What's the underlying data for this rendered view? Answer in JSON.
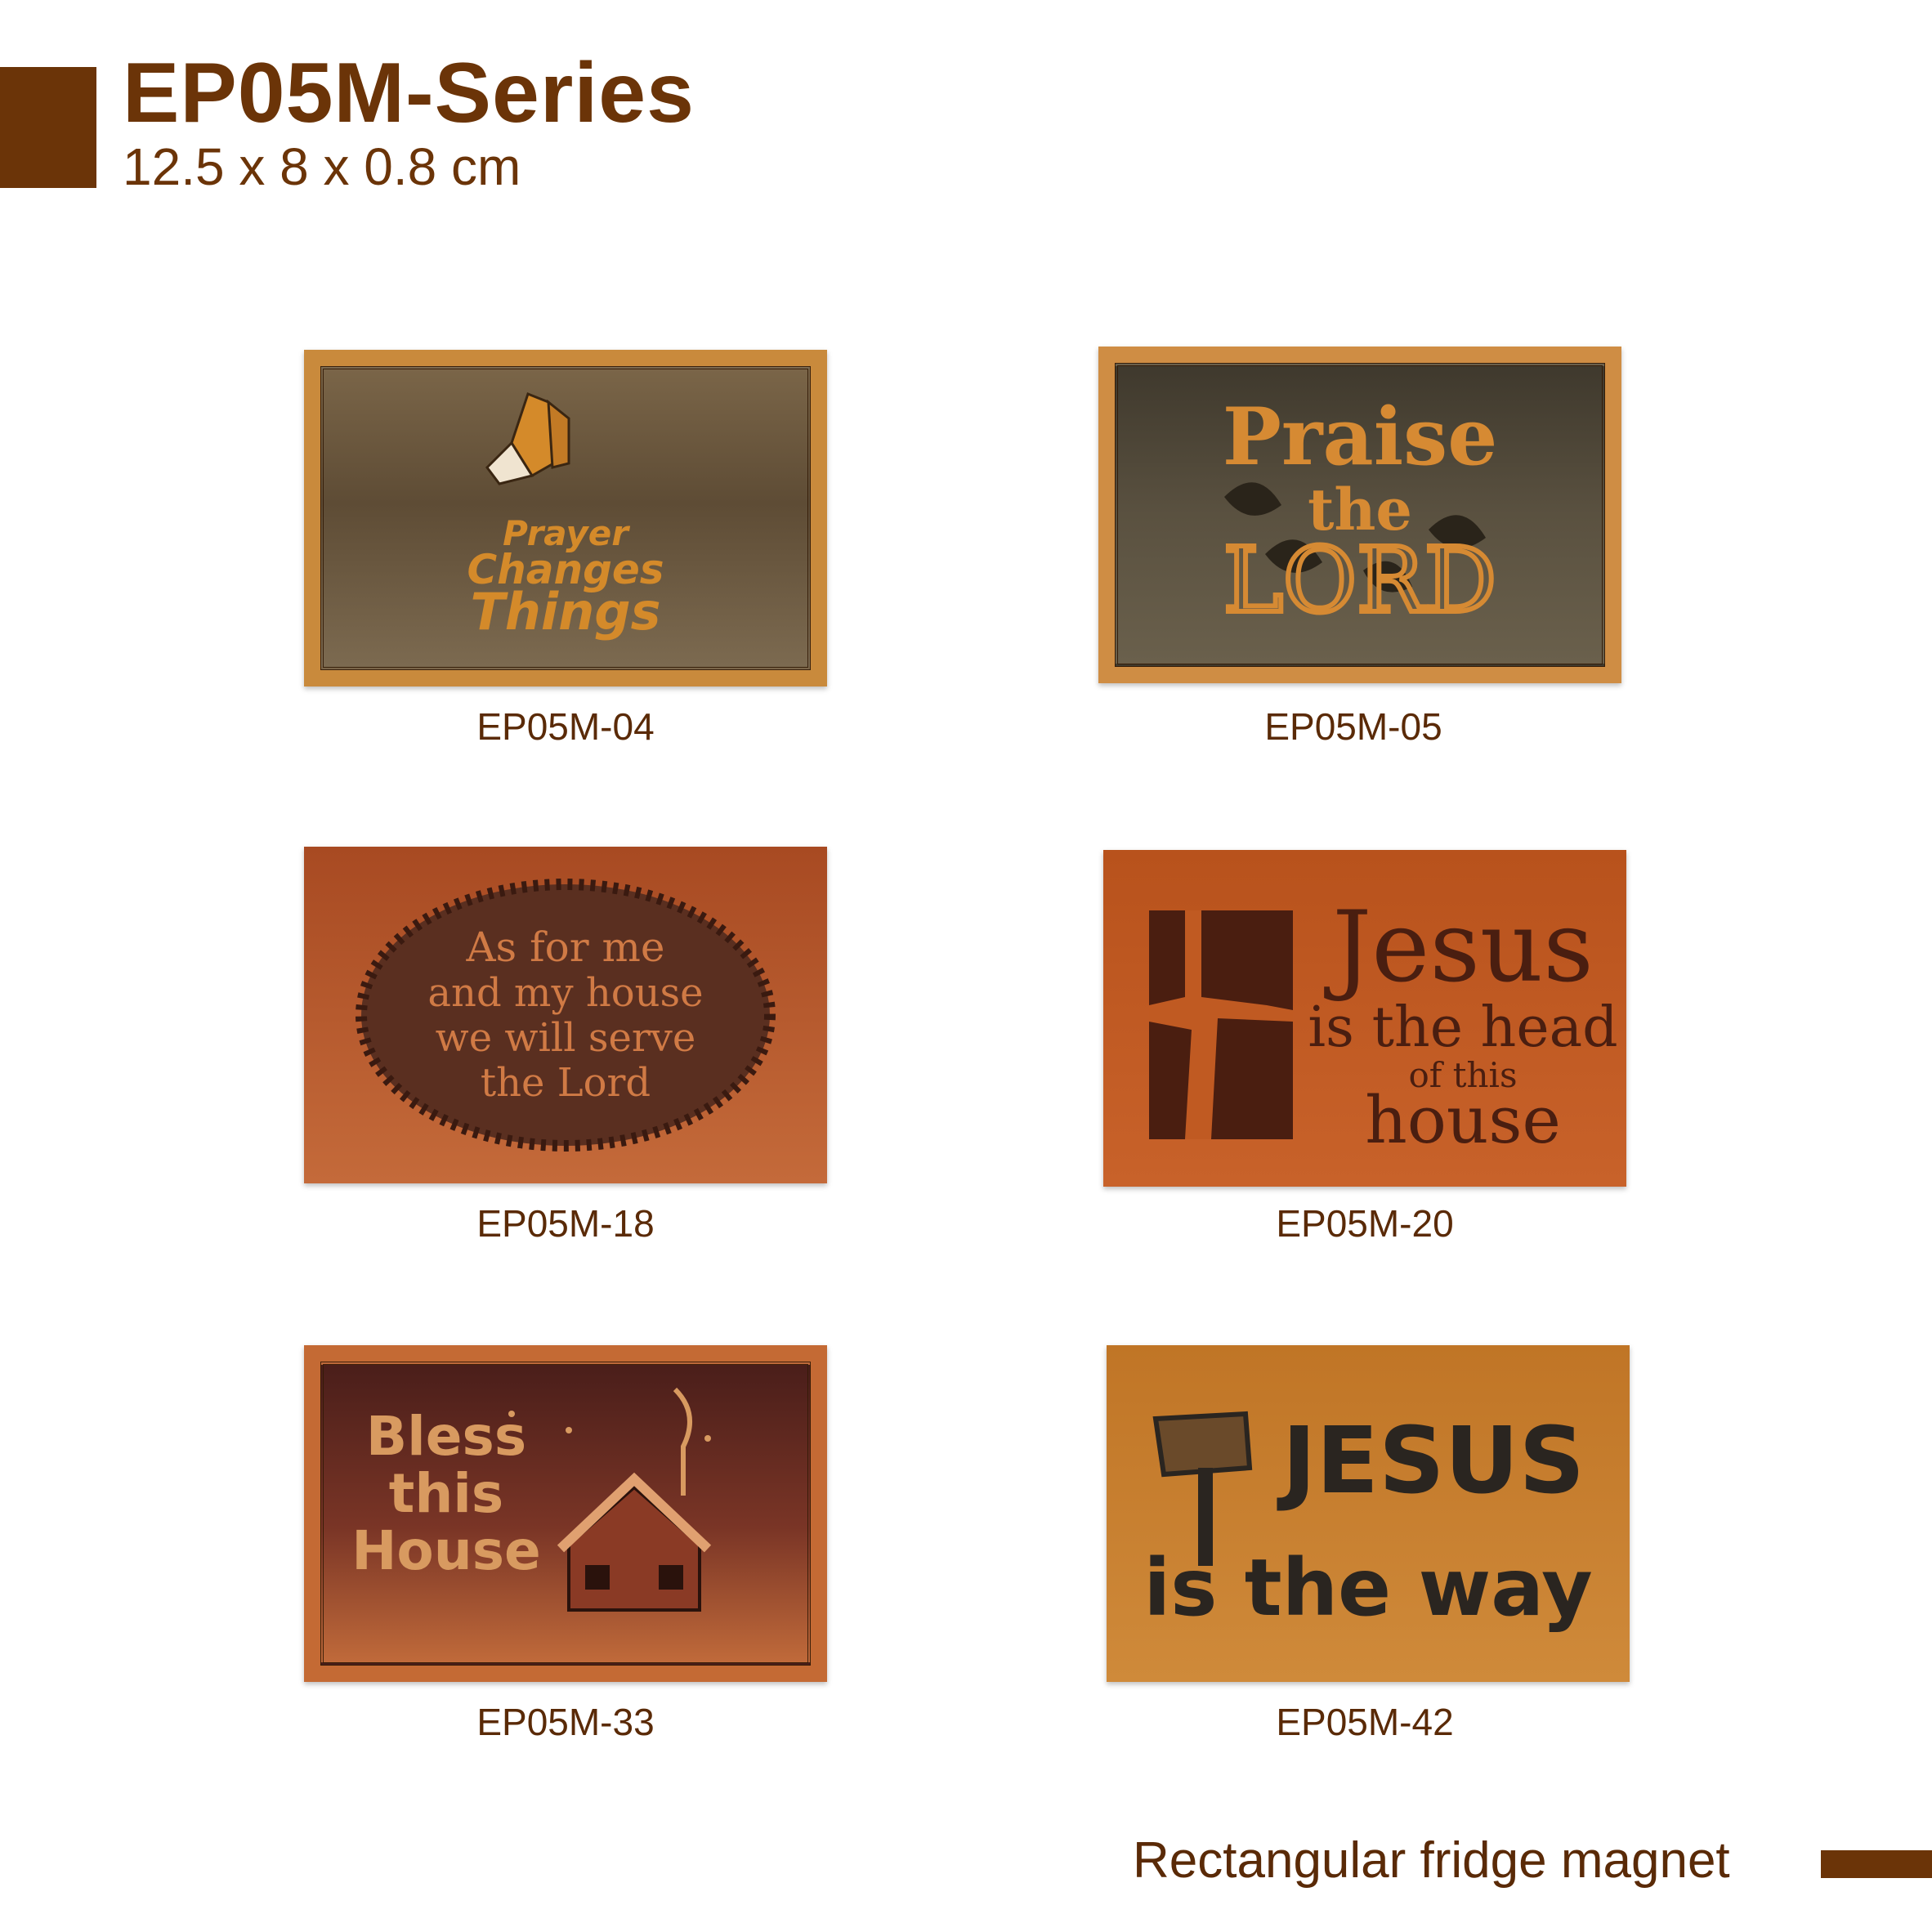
{
  "header": {
    "title": "EP05M-Series",
    "dimensions": "12.5 x 8 x 0.8 cm"
  },
  "products": [
    {
      "code": "EP05M-04",
      "lines": [
        "Prayer",
        "Changes",
        "Things"
      ],
      "wood": "#c98a3c",
      "panel": "#6e5a40",
      "ink": "#d48a2a"
    },
    {
      "code": "EP05M-05",
      "lines": [
        "Praise",
        "the",
        "LORD"
      ],
      "wood": "#cf8d44",
      "panel": "#4f4636",
      "ink": "#d68a33"
    },
    {
      "code": "EP05M-18",
      "lines": [
        "As for me",
        "and my house",
        "we will serve",
        "the Lord"
      ],
      "wood": "#b8582a",
      "panel": "#5a2f20",
      "ink": "#d07a45"
    },
    {
      "code": "EP05M-20",
      "lines": [
        "Jesus",
        "is the head",
        "of this",
        "house"
      ],
      "wood": "#c05a22",
      "panel": "#c05a22",
      "ink": "#4a1e10"
    },
    {
      "code": "EP05M-33",
      "lines": [
        "Bless",
        "this",
        "House"
      ],
      "wood": "#c46a34",
      "panel": "#6a2e22",
      "ink": "#d89a60"
    },
    {
      "code": "EP05M-42",
      "lines": [
        "JESUS",
        "is the way"
      ],
      "wood": "#c67e2e",
      "panel": "#c67e2e",
      "ink": "#2a2520"
    }
  ],
  "footer": {
    "label": "Rectangular fridge magnet"
  }
}
